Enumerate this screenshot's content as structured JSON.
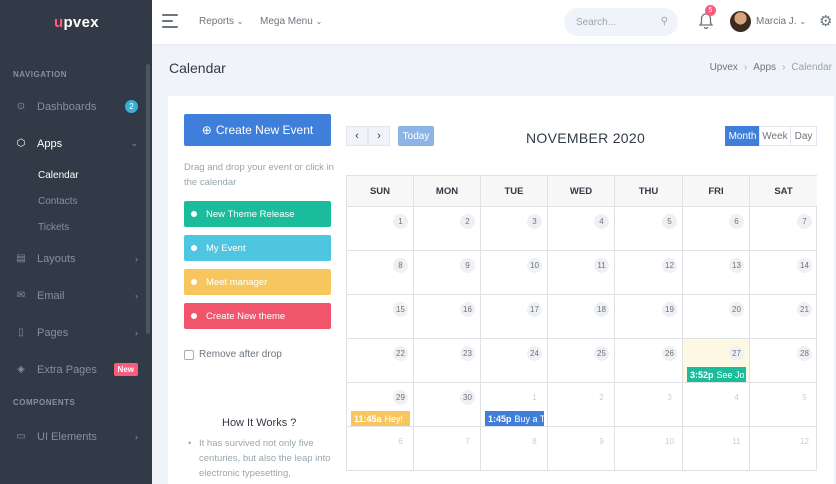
{
  "brand": {
    "logo": "upvex",
    "accent": "#fa5c7c"
  },
  "sidebar": {
    "section_navigation": "NAVIGATION",
    "section_components": "COMPONENTS",
    "items": [
      {
        "label": "Dashboards",
        "icon": "dashboard-icon",
        "badge": "2"
      },
      {
        "label": "Apps",
        "icon": "cube-icon",
        "expanded": true
      },
      {
        "label": "Layouts",
        "icon": "layout-icon"
      },
      {
        "label": "Email",
        "icon": "mail-icon"
      },
      {
        "label": "Pages",
        "icon": "page-icon"
      },
      {
        "label": "Extra Pages",
        "icon": "gem-icon",
        "badge": "New"
      },
      {
        "label": "UI Elements",
        "icon": "briefcase-icon"
      }
    ],
    "apps_sub": [
      "Calendar",
      "Contacts",
      "Tickets"
    ]
  },
  "topbar": {
    "menu_reports": "Reports",
    "menu_mega": "Mega Menu",
    "search_placeholder": "Search...",
    "notif_count": "5",
    "user_name": "Marcia J."
  },
  "page": {
    "title": "Calendar",
    "breadcrumb": [
      "Upvex",
      "Apps",
      "Calendar"
    ]
  },
  "panel": {
    "create_button": "Create New Event",
    "hint": "Drag and drop your event or click in the calendar",
    "external_events": [
      {
        "label": "New Theme Release",
        "color": "#1abc9c"
      },
      {
        "label": "My Event",
        "color": "#4fc6e1"
      },
      {
        "label": "Meet manager",
        "color": "#f7c65f"
      },
      {
        "label": "Create New theme",
        "color": "#f1556c"
      }
    ],
    "remove_after_drop": "Remove after drop",
    "how_title": "How It Works ?",
    "how_text": "It has survived not only five centuries, but also the leap into electronic typesetting,"
  },
  "calendar": {
    "prev": "‹",
    "next": "›",
    "today": "Today",
    "title": "NOVEMBER 2020",
    "views": [
      "Month",
      "Week",
      "Day"
    ],
    "active_view": "Month",
    "weekdays": [
      "SUN",
      "MON",
      "TUE",
      "WED",
      "THU",
      "FRI",
      "SAT"
    ],
    "weeks": [
      [
        1,
        2,
        3,
        4,
        5,
        6,
        7
      ],
      [
        8,
        9,
        10,
        11,
        12,
        13,
        14
      ],
      [
        15,
        16,
        17,
        18,
        19,
        20,
        21
      ],
      [
        22,
        23,
        24,
        25,
        26,
        27,
        28
      ],
      [
        29,
        30,
        1,
        2,
        3,
        4,
        5
      ],
      [
        6,
        7,
        8,
        9,
        10,
        11,
        12
      ]
    ],
    "highlight": {
      "week": 3,
      "day": 5
    },
    "events": [
      {
        "week": 3,
        "day": 5,
        "time": "3:52p",
        "title": "See Jo",
        "color": "#1abc9c"
      },
      {
        "week": 4,
        "day": 0,
        "time": "11:45a",
        "title": "Hey!",
        "color": "#f7c65f"
      },
      {
        "week": 4,
        "day": 2,
        "time": "1:45p",
        "title": "Buy a T",
        "color": "#3f7fd9"
      }
    ]
  }
}
